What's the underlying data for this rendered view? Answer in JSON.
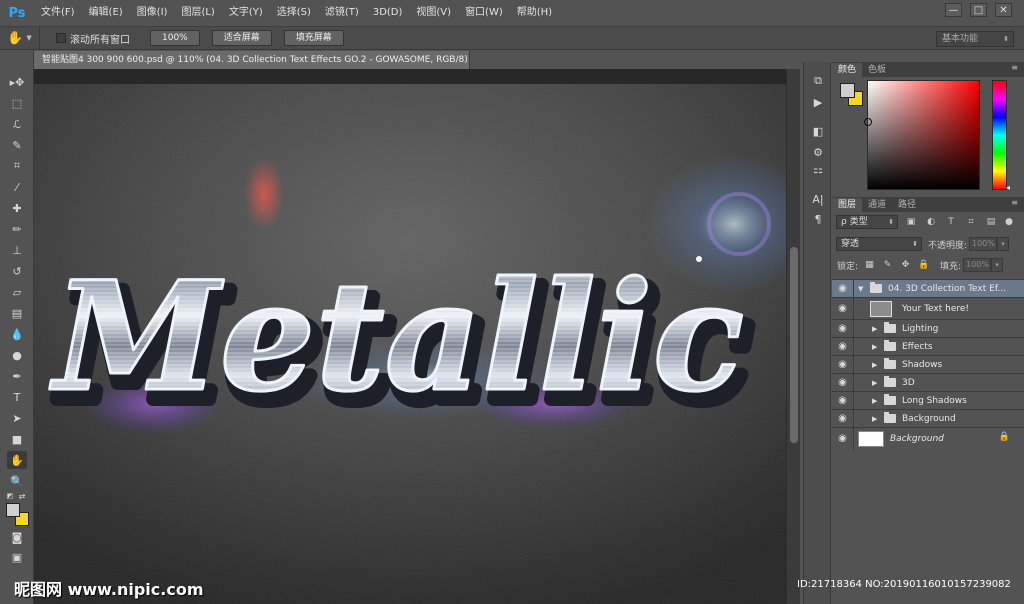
{
  "app": {
    "logo": "Ps"
  },
  "menu": [
    "文件(F)",
    "编辑(E)",
    "图像(I)",
    "图层(L)",
    "文字(Y)",
    "选择(S)",
    "滤镜(T)",
    "3D(D)",
    "视图(V)",
    "窗口(W)",
    "帮助(H)"
  ],
  "window_controls": {
    "minimize": "—",
    "maximize": "□",
    "close": "✕"
  },
  "options": {
    "scroll_all_label": "滚动所有窗口",
    "zoom_100": "100%",
    "fit_screen": "适合屏幕",
    "fill_screen": "填充屏幕",
    "workspace": "基本功能"
  },
  "document": {
    "tab_title": "智能贴图4 300 900 600.psd @ 110% (04. 3D Collection Text Effects GO.2 - GOWASOME, RGB/8) *",
    "close": "×",
    "artwork_text": "Metallic"
  },
  "color_panel": {
    "tabs": [
      "颜色",
      "色板"
    ]
  },
  "layers_panel": {
    "tabs": [
      "图层",
      "通道",
      "路径"
    ],
    "kind_filter": "ρ 类型",
    "blend_mode": "穿透",
    "opacity_label": "不透明度:",
    "opacity_value": "100%",
    "lock_label": "锁定:",
    "fill_label": "填充:",
    "fill_value": "100%",
    "layers": [
      {
        "name": "04. 3D Collection Text Ef...",
        "type": "group-open"
      },
      {
        "name": "Your Text here!",
        "type": "smart"
      },
      {
        "name": "Lighting",
        "type": "group"
      },
      {
        "name": "Effects",
        "type": "group"
      },
      {
        "name": "Shadows",
        "type": "group"
      },
      {
        "name": "3D",
        "type": "group"
      },
      {
        "name": "Long Shadows",
        "type": "group"
      },
      {
        "name": "Background",
        "type": "group"
      },
      {
        "name": "Background",
        "type": "background"
      }
    ]
  },
  "colors": {
    "foreground": "#cfcfcf",
    "background": "#f6d62a",
    "accent": "#31a8ff"
  },
  "watermark": {
    "left": "昵图网 www.nipic.com",
    "right": "ID:21718364 NO:20190116010157239082"
  }
}
